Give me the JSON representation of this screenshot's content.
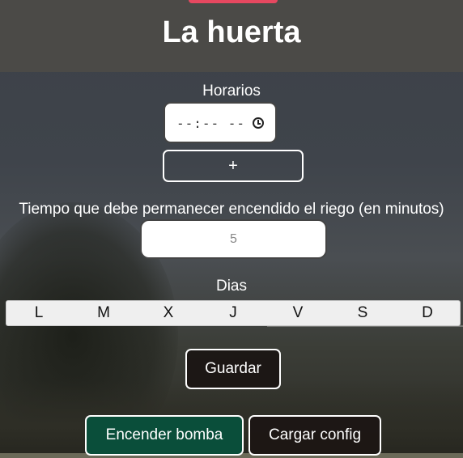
{
  "app": {
    "title": "La huerta",
    "accent_color": "#e64860"
  },
  "schedule": {
    "label": "Horarios",
    "time_value": "--:-- --",
    "time_icon": "clock-icon",
    "add_label": "+"
  },
  "duration": {
    "label": "Tiempo que debe permanecer encendido el riego (en minutos)",
    "placeholder": "5"
  },
  "days": {
    "label": "Dias",
    "items": [
      "L",
      "M",
      "X",
      "J",
      "V",
      "S",
      "D"
    ]
  },
  "actions": {
    "save_label": "Guardar",
    "pump_label": "Encender bomba",
    "pump_color": "#0a4e3a",
    "load_label": "Cargar config"
  }
}
